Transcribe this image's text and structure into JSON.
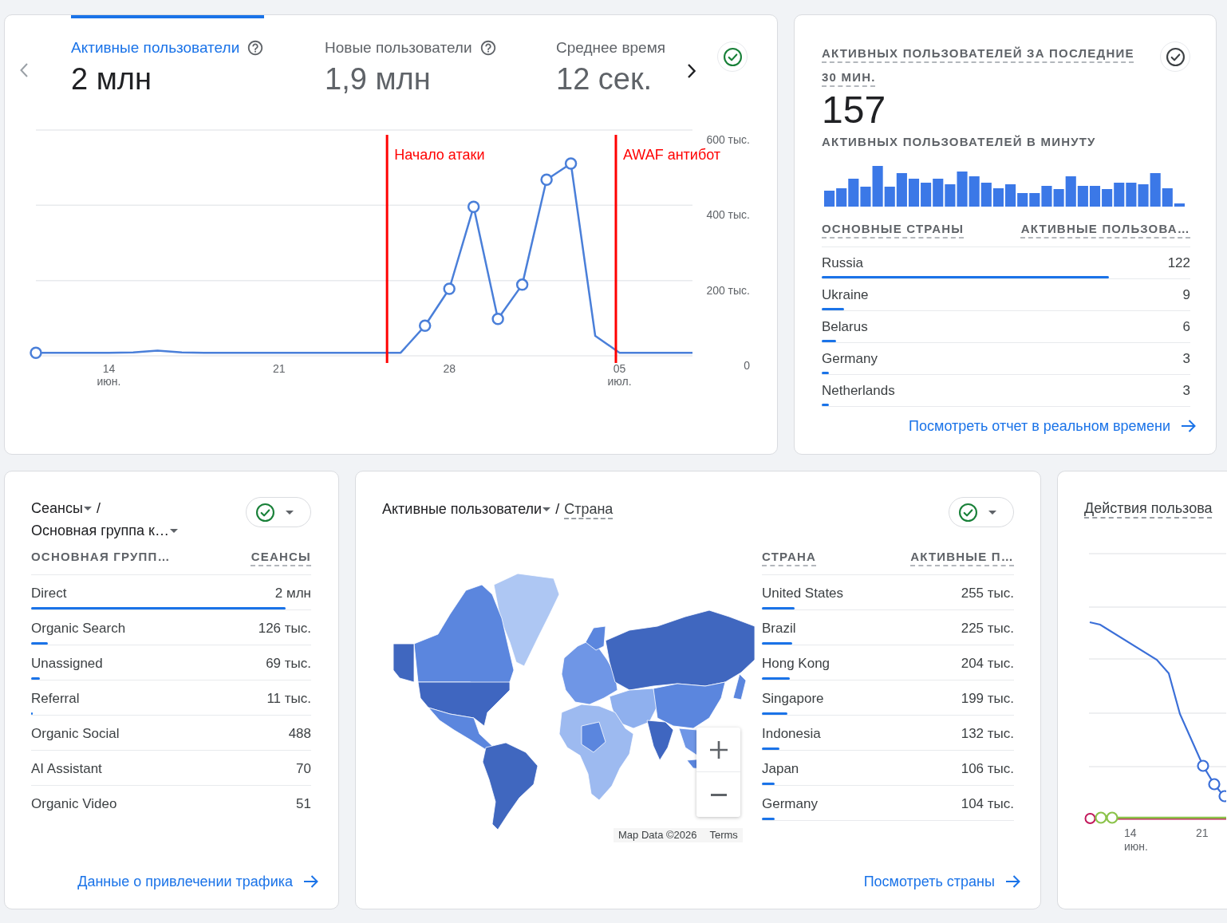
{
  "overview_card": {
    "tabs": [
      {
        "label": "Активные пользователи",
        "value": "2 млн",
        "selected": true,
        "info": true
      },
      {
        "label": "Новые пользователи",
        "value": "1,9 млн",
        "selected": false,
        "info": true
      },
      {
        "label": "Среднее время",
        "value": "12 сек.",
        "selected": false,
        "info": false
      }
    ],
    "chart_notes": [
      "Начало атаки",
      "AWAF антибот"
    ],
    "chart_data": {
      "type": "line",
      "categories": [
        null,
        null,
        null,
        "14 июн.",
        null,
        null,
        null,
        null,
        null,
        null,
        "21",
        null,
        null,
        null,
        null,
        null,
        null,
        "28",
        null,
        null,
        null,
        null,
        null,
        null,
        "05 июл.",
        null,
        null,
        null
      ],
      "values": [
        8,
        8,
        8,
        8,
        9,
        14,
        9,
        8,
        8,
        8,
        8,
        8,
        8,
        8,
        8,
        8,
        80,
        178,
        396,
        98,
        189,
        468,
        511,
        53,
        8,
        8,
        8,
        8
      ],
      "ylim": [
        0,
        600
      ],
      "yticks": [
        {
          "value": 0,
          "label": "0"
        },
        {
          "value": 200,
          "label": "200 тыс."
        },
        {
          "value": 400,
          "label": "400 тыс."
        },
        {
          "value": 600,
          "label": "600 тыс."
        }
      ],
      "grid": true
    }
  },
  "realtime_card": {
    "title": "АКТИВНЫХ ПОЛЬЗОВАТЕЛЕЙ ЗА ПОСЛЕДНИЕ 30 МИН.",
    "value": "157",
    "subtitle": "АКТИВНЫХ ПОЛЬЗОВАТЕЛЕЙ В МИНУТУ",
    "columns": [
      {
        "label": "ОСНОВНЫЕ СТРАНЫ",
        "underlined": true
      },
      {
        "label": "АКТИВНЫЕ ПОЛЬЗОВА…",
        "underlined": true
      }
    ],
    "rows": [
      {
        "name": "Russia",
        "value": "122",
        "level": 0.78
      },
      {
        "name": "Ukraine",
        "value": "9",
        "level": 0.06
      },
      {
        "name": "Belarus",
        "value": "6",
        "level": 0.04
      },
      {
        "name": "Germany",
        "value": "3",
        "level": 0.02
      },
      {
        "name": "Netherlands",
        "value": "3",
        "level": 0.02
      }
    ],
    "link": "Посмотреть отчет в реальном времени"
  },
  "traffic_card": {
    "title_parts": [
      {
        "kind": "dropdown",
        "text": "Сеансы"
      },
      {
        "kind": "separator",
        "text": "/"
      },
      {
        "kind": "dropdown",
        "text": "Основная группа к…"
      }
    ],
    "columns": [
      {
        "label": "ОСНОВНАЯ ГРУПП…",
        "underlined": false
      },
      {
        "label": "СЕАНСЫ",
        "underlined": true
      }
    ],
    "rows": [
      {
        "name": "Direct",
        "value": "2 млн",
        "level": 0.91
      },
      {
        "name": "Organic Search",
        "value": "126 тыс.",
        "level": 0.06
      },
      {
        "name": "Unassigned",
        "value": "69 тыс.",
        "level": 0.03
      },
      {
        "name": "Referral",
        "value": "11 тыс.",
        "level": 0.005
      },
      {
        "name": "Organic Social",
        "value": "488"
      },
      {
        "name": "AI Assistant",
        "value": "70"
      },
      {
        "name": "Organic Video",
        "value": "51"
      }
    ],
    "link": "Данные о привлечении трафика"
  },
  "country_card": {
    "title_parts": [
      {
        "kind": "dropdown",
        "text": "Активные пользователи"
      },
      {
        "kind": "separator",
        "text": "/"
      },
      {
        "kind": "term",
        "text": "Страна"
      }
    ],
    "map": {
      "attribution": "Map Data ©2026",
      "terms": "Terms"
    },
    "columns": [
      {
        "label": "СТРАНА",
        "underlined": true
      },
      {
        "label": "АКТИВНЫЕ П…",
        "underlined": true
      }
    ],
    "rows": [
      {
        "name": "United States",
        "value": "255 тыс.",
        "level": 0.13
      },
      {
        "name": "Brazil",
        "value": "225 тыс.",
        "level": 0.12
      },
      {
        "name": "Hong Kong",
        "value": "204 тыс.",
        "level": 0.11
      },
      {
        "name": "Singapore",
        "value": "199 тыс.",
        "level": 0.1
      },
      {
        "name": "Indonesia",
        "value": "132 тыс.",
        "level": 0.07
      },
      {
        "name": "Japan",
        "value": "106 тыс.",
        "level": 0.05
      },
      {
        "name": "Germany",
        "value": "104 тыс.",
        "level": 0.05
      }
    ],
    "link": "Посмотреть страны"
  },
  "user_actions_card": {
    "title": "Действия пользова",
    "x_labels": [
      "14 июн.",
      "21"
    ]
  }
}
